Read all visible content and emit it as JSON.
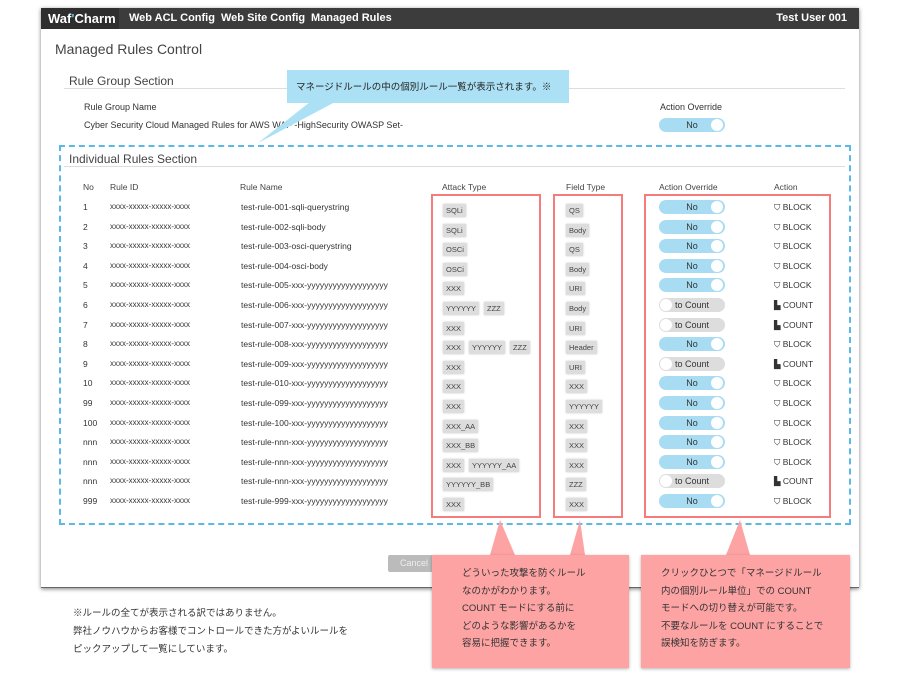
{
  "nav": {
    "logo": "Waf Charm",
    "items": [
      "Web ACL Config",
      "Web Site Config",
      "Managed Rules"
    ],
    "user": "Test User 001"
  },
  "page_title": "Managed Rules Control",
  "rule_group": {
    "section": "Rule Group Section",
    "name_label": "Rule Group Name",
    "name": "Cyber Security Cloud Managed Rules for AWS WAF -HighSecurity OWASP Set-",
    "override_label": "Action Override",
    "override_value": "No"
  },
  "individual": {
    "section": "Individual Rules Section",
    "headers": [
      "No",
      "Rule ID",
      "Rule Name",
      "Attack Type",
      "Field Type",
      "Action Override",
      "Action"
    ],
    "rows": [
      {
        "no": "1",
        "id": "xxxx-xxxxx-xxxxx-xxxx",
        "name": "test-rule-001-sqli-querystring",
        "attack": [
          "SQLi"
        ],
        "field": "QS",
        "override": "No",
        "action": "BLOCK"
      },
      {
        "no": "2",
        "id": "xxxx-xxxxx-xxxxx-xxxx",
        "name": "test-rule-002-sqli-body",
        "attack": [
          "SQLi"
        ],
        "field": "Body",
        "override": "No",
        "action": "BLOCK"
      },
      {
        "no": "3",
        "id": "xxxx-xxxxx-xxxxx-xxxx",
        "name": "test-rule-003-osci-querystring",
        "attack": [
          "OSCi"
        ],
        "field": "QS",
        "override": "No",
        "action": "BLOCK"
      },
      {
        "no": "4",
        "id": "xxxx-xxxxx-xxxxx-xxxx",
        "name": "test-rule-004-osci-body",
        "attack": [
          "OSCi"
        ],
        "field": "Body",
        "override": "No",
        "action": "BLOCK"
      },
      {
        "no": "5",
        "id": "xxxx-xxxxx-xxxxx-xxxx",
        "name": "test-rule-005-xxx-yyyyyyyyyyyyyyyyyyy",
        "attack": [
          "XXX"
        ],
        "field": "URI",
        "override": "No",
        "action": "BLOCK"
      },
      {
        "no": "6",
        "id": "xxxx-xxxxx-xxxxx-xxxx",
        "name": "test-rule-006-xxx-yyyyyyyyyyyyyyyyyyy",
        "attack": [
          "YYYYYY",
          "ZZZ"
        ],
        "field": "Body",
        "override": "to Count",
        "action": "COUNT"
      },
      {
        "no": "7",
        "id": "xxxx-xxxxx-xxxxx-xxxx",
        "name": "test-rule-007-xxx-yyyyyyyyyyyyyyyyyyy",
        "attack": [
          "XXX"
        ],
        "field": "URI",
        "override": "to Count",
        "action": "COUNT"
      },
      {
        "no": "8",
        "id": "xxxx-xxxxx-xxxxx-xxxx",
        "name": "test-rule-008-xxx-yyyyyyyyyyyyyyyyyyy",
        "attack": [
          "XXX",
          "YYYYYY",
          "ZZZ"
        ],
        "field": "Header",
        "override": "No",
        "action": "BLOCK"
      },
      {
        "no": "9",
        "id": "xxxx-xxxxx-xxxxx-xxxx",
        "name": "test-rule-009-xxx-yyyyyyyyyyyyyyyyyyy",
        "attack": [
          "XXX"
        ],
        "field": "URI",
        "override": "to Count",
        "action": "COUNT"
      },
      {
        "no": "10",
        "id": "xxxx-xxxxx-xxxxx-xxxx",
        "name": "test-rule-010-xxx-yyyyyyyyyyyyyyyyyyy",
        "attack": [
          "XXX"
        ],
        "field": "XXX",
        "override": "No",
        "action": "BLOCK"
      },
      {
        "no": "99",
        "id": "xxxx-xxxxx-xxxxx-xxxx",
        "name": "test-rule-099-xxx-yyyyyyyyyyyyyyyyyyy",
        "attack": [
          "XXX"
        ],
        "field": "YYYYYY",
        "override": "No",
        "action": "BLOCK"
      },
      {
        "no": "100",
        "id": "xxxx-xxxxx-xxxxx-xxxx",
        "name": "test-rule-100-xxx-yyyyyyyyyyyyyyyyyyy",
        "attack": [
          "XXX_AA"
        ],
        "field": "XXX",
        "override": "No",
        "action": "BLOCK"
      },
      {
        "no": "nnn",
        "id": "xxxx-xxxxx-xxxxx-xxxx",
        "name": "test-rule-nnn-xxx-yyyyyyyyyyyyyyyyyyy",
        "attack": [
          "XXX_BB"
        ],
        "field": "XXX",
        "override": "No",
        "action": "BLOCK"
      },
      {
        "no": "nnn",
        "id": "xxxx-xxxxx-xxxxx-xxxx",
        "name": "test-rule-nnn-xxx-yyyyyyyyyyyyyyyyyyy",
        "attack": [
          "XXX",
          "YYYYYY_AA"
        ],
        "field": "XXX",
        "override": "No",
        "action": "BLOCK"
      },
      {
        "no": "nnn",
        "id": "xxxx-xxxxx-xxxxx-xxxx",
        "name": "test-rule-nnn-xxx-yyyyyyyyyyyyyyyyyyy",
        "attack": [
          "YYYYYY_BB"
        ],
        "field": "ZZZ",
        "override": "to Count",
        "action": "COUNT"
      },
      {
        "no": "999",
        "id": "xxxx-xxxxx-xxxxx-xxxx",
        "name": "test-rule-999-xxx-yyyyyyyyyyyyyyyyyyy",
        "attack": [
          "XXX"
        ],
        "field": "XXX",
        "override": "No",
        "action": "BLOCK"
      }
    ]
  },
  "cancel_label": "Cancel",
  "callouts": {
    "blue": "マネージドルールの中の個別ルール一覧が表示されます。※",
    "left": [
      "どういった攻撃を防ぐルール",
      "なのかがわかります。",
      "COUNT モードにする前に",
      "どのような影響があるかを",
      "容易に把握できます。"
    ],
    "right": [
      "クリックひとつで「マネージドルール",
      "内の個別ルール単位」での COUNT",
      "モードへの切り替えが可能です。",
      "不要なルールを COUNT にすることで",
      "誤検知を防ぎます。"
    ]
  },
  "footnote": [
    "※ルールの全てが表示される訳ではありません。",
    "弊社ノウハウからお客様でコントロールできた方がよいルールを",
    "ピックアップして一覧にしています。"
  ],
  "colors": {
    "nav": "#3c3c3c",
    "toggle_on": "#a8dcf2",
    "highlight_red": "#f47c7c",
    "callout_blue": "#ace0f5",
    "callout_pink": "#fda3a3"
  }
}
